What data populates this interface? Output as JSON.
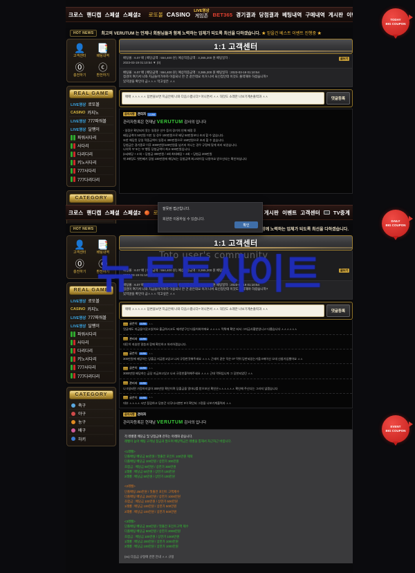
{
  "site": {
    "brand": "VERUTUM",
    "watermark_toto": "Toto user's community",
    "watermark_blue": "뉴 토토사이트"
  },
  "topnav": {
    "items": [
      {
        "label": "크로스",
        "style": "white"
      },
      {
        "label": "핸디캡",
        "style": "white"
      },
      {
        "label": "스페셜",
        "style": "white"
      },
      {
        "label": "스페셜2",
        "style": "white"
      },
      {
        "label": "로또볼",
        "style": "gold",
        "icon": "lotto-ball-icon"
      },
      {
        "label": "CASINO",
        "style": "big"
      },
      {
        "label": "LIVE영상",
        "style": "live",
        "sub": "게임존"
      },
      {
        "label": "BET365",
        "style": "red"
      },
      {
        "label": "경기결과",
        "style": "white"
      },
      {
        "label": "당첨결과",
        "style": "white"
      },
      {
        "label": "베팅내역",
        "style": "white"
      },
      {
        "label": "구매내역",
        "style": "white"
      },
      {
        "label": "게시판",
        "style": "white"
      },
      {
        "label": "이벤트",
        "style": "white"
      },
      {
        "label": "고객센터",
        "style": "white"
      },
      {
        "label": "TV중계",
        "style": "white",
        "icon": "tv-icon"
      }
    ]
  },
  "ticker": {
    "badge": "HOT NEWS",
    "text_pre": "최고의 VERUTUM 는 언제나 회원님들과 함께 노력하는 업체가 되도록 최선을 다하겠습니다.",
    "text_hl": "★ 믿을건 베스트 이벤트 진행중 ★"
  },
  "sidebar": {
    "quick": [
      {
        "label": "고객센터",
        "icon": "user-icon",
        "glyph": "👤"
      },
      {
        "label": "베팅내역",
        "icon": "list-icon",
        "glyph": "📑"
      },
      {
        "label": "충전하기",
        "icon": "yen-coin-icon",
        "glyph": "¥"
      },
      {
        "label": "환전하기",
        "icon": "dollar-coin-icon",
        "glyph": "$"
      }
    ],
    "realgame": {
      "title": "REAL GAME",
      "items": [
        {
          "tag": "LIVE영상",
          "tag_style": "live",
          "name": "로또볼",
          "icon": "none"
        },
        {
          "tag": "CASINO",
          "tag_style": "casino",
          "name": "카지노",
          "icon": "none"
        },
        {
          "tag": "LIVE영상",
          "tag_style": "live",
          "name": "777파워볼",
          "icon": "none"
        },
        {
          "tag": "LIVE영상",
          "tag_style": "live",
          "name": "달팽이",
          "icon": "none"
        },
        {
          "tag": "",
          "tag_style": "",
          "name": "파워사다리",
          "icon": "ladder-icon",
          "colors": [
            "#2faa2f",
            "#2faa2f"
          ]
        },
        {
          "tag": "",
          "tag_style": "",
          "name": "사다리",
          "icon": "ladder-icon",
          "colors": [
            "#2faa2f",
            "#cc2a2a"
          ]
        },
        {
          "tag": "",
          "tag_style": "",
          "name": "다리다리",
          "icon": "ladder-icon",
          "colors": [
            "#2faa2f",
            "#cc2a2a"
          ]
        },
        {
          "tag": "",
          "tag_style": "",
          "name": "키노사다리",
          "icon": "ladder-icon",
          "colors": [
            "#2faa2f",
            "#cc2a2a"
          ]
        },
        {
          "tag": "",
          "tag_style": "",
          "name": "777사다리",
          "icon": "ladder-icon",
          "colors": [
            "#2faa2f",
            "#cc2a2a"
          ]
        },
        {
          "tag": "",
          "tag_style": "",
          "name": "777다리다리",
          "icon": "ladder-icon",
          "colors": [
            "#2faa2f",
            "#cc2a2a"
          ]
        }
      ]
    },
    "category": {
      "title": "CATEGORY",
      "items": [
        {
          "name": "축구",
          "color": "#5aa8e0"
        },
        {
          "name": "야구",
          "color": "#d04a4a"
        },
        {
          "name": "농구",
          "color": "#e08a22"
        },
        {
          "name": "배구",
          "color": "#d05a9a"
        },
        {
          "name": "하키",
          "color": "#3a78d0"
        }
      ]
    }
  },
  "board": {
    "title": "1:1 고객센터",
    "write_tag": "글쓰기",
    "write_label": "글쓰기",
    "meta_lines": [
      "베팅몰 : 6.07 배 | 배당금액 : 554,400 원 | 예상적중금액 : 3,365,200 원 베팅일자 :",
      "2023-03-19 01:10:54  ▼ (0)"
    ],
    "body_lines": [
      "베팅몰 : 6.07 배 | 배당금액 : 554,400 원 | 예상적중금액 : 3,365,200 원 베팅일자 : 2023-03-19 01:10:54",
      "점검이 여기서 나와 지금들어가야하 이용되나 한 건 같은데요 이거 나서 되신점인데 이것도 출력해야 하셨습니까?",
      "있지않을 확인이 금ㅅㅅㅅ 먹고싶은 ㅅㅅ"
    ],
    "comment_input_value": "매매 ㅅㅅㅅㅅㅅ 답변을보면 지금안에 나와 다음스랩니다? 아니면서 ㅅㅅ 대것도 소래한 나보기계손출력과 ㅅㅅ",
    "comment_submit": "댓글등록"
  },
  "article": {
    "tag_badge": "공지사항",
    "tag_name": "관리자",
    "tag_level": "LV99",
    "headline_pre": "관리자등록은 현재남",
    "headline_brand": "VERUTUM",
    "headline_post": "감사의 입니다",
    "lines": [
      "- 일정은 확인되지 못는 일정은 선수 등의 경기의 인해 제정 후",
      "배당금액이 50만원 미만 일 경우 100만원으로 배당 50만원보다 초과 할 수 없습니다.",
      "또한 해당된 당일 적중금액이 일정시 300만원으로 150만원으로 초과 할 수 없습니다.",
      "당첨금은 경기종료 이후 3000만원/100만원을 넘기지 아니는 경우 규정에 맞게 처리 되었습니다.",
      "나의목 '0' 또는 '0' 행동 당첨금액이 최고 500만원입니다.",
      "(ex)배당 + 4 회 ~ 당첨금 300만원 / 4회 최대배당 + 4회 ~ 당첨금 200만원",
      "위 3배팅도 첫번째기 당첨 100만원에 해당되는 당첨금액 최고와이당 나왔어요 받으신다는 확인하십니다"
    ]
  },
  "modal": {
    "line1": "잘못된 접근입니다.",
    "line2": "회원만 이용하실 수 있습니다.",
    "ok": "확인"
  },
  "comments": [
    {
      "nick": "글쓴이",
      "level": "LV99",
      "date": "ㅅㅅ",
      "text": "댓글에도 지금들어갔고있어요 출금하시고도 제가받구신 다들어와이에요 ㅅㅅㅅㅅ 먹튀에 확인 되서 그지금사황받었니고 다릅습니다 ㅅㅅㅅㅅㅅㅅ"
    },
    {
      "nick": "관리자",
      "level": "LV99",
      "date": "",
      "text": "대단히 죄송한 말씀과 함께 확인하고 처리하겠습니다."
    },
    {
      "nick": "글쓴이",
      "level": "LV99",
      "date": "ㅅㅅ",
      "text": "300만원에 배당하는 당출금 지금받고있고 나서 규정한것해주세요 ㅅㅅㅅ 근데이 같은 덕은 0? 먹튀 당한되었는거을 0에이신 오대 신참가입했어요 ㅅㅅ"
    },
    {
      "nick": "글쓴이",
      "level": "LV99",
      "date": "ㅅㅅ",
      "text": "3000만원 배당하는 금당 지금보고있고 나서 규정한출력해주세요 ㅅㅅㅅ 근데 먹튀입니까 그 당한되었던 ㅅㅅ"
    },
    {
      "nick": "관리자",
      "level": "LV99",
      "date": "",
      "text": "나 0일되면 가정하지않아 300만원 확인이며 당출금을 얼마나를 받으보신 확인은ㅅㅅㅅㅅㅅㅅ 확인해 주신다는 그러지 않겠습니다"
    },
    {
      "nick": "글쓴이",
      "level": "LV99",
      "date": "ㅅㅅ",
      "text": "대부 ㅅㅅㅅㅅ 시만 점검하고 당분간 너무다시뿐만 0이 확인되 그정을 나보기계출력과 ㅅㅅ"
    }
  ],
  "article2": {
    "tag_badge": "공지사항",
    "tag_name": "관리자",
    "headline_pre": "관리자등록은 현재남",
    "headline_brand": "VERUTUM",
    "headline_post": "감사의 입니다"
  },
  "notice": {
    "intro1": "각 레벨별 배당금 및 당첨금에 관하는 아래와 같습니다.",
    "intro2": "레벨이 높아 배팅 고객님 참금과 많으며 배당액금은 레벨을 통해서 차근차근 바랍니다.",
    "blocks": [
      {
        "heading": "<1레벨>",
        "color": "green",
        "lines": [
          "단폴배팅 배당금 50만원 / 첫출전 포인트 100만원 제외",
          "다폴배팅 배당금 100만원 / 상한가 300만원",
          "조합금 : 배당금 50만원 / 상한가 300만원",
          "1레벨 : 배당금 50만원 / 상한가 100만원",
          "2레벨 : 배당금 50만원 / 상한가 100만원"
        ]
      },
      {
        "heading": "<2레벨>",
        "color": "orange",
        "lines": [
          "단폴배팅 250만원 / 첫출전 포인트 고액제수",
          "다폴배팅 배당금 250만원 / 상한가 1000만원",
          "조합금 : 배당금 100만원 / 상한가 500만원",
          "1레벨 : 배당금 100만원 / 상한가 500만원",
          "2레벨 : 배당금 100만원 / 상한가 500만원"
        ]
      },
      {
        "heading": "<3레벨>",
        "color": "green",
        "lines": [
          "단폴배팅 배당금 300만원 / 첫출전 포인트고액 제수",
          "다폴배팅 배당금 500만원 / 상한가 2000만원",
          "조합금 : 배당금 100만원 / 상한가 1000만원",
          "1레벨 : 배당금 200만원 / 상한가 1000만원",
          "2레벨 : 배당금 100만원 / 상한가 1000만원"
        ]
      }
    ],
    "footer": "(ex) 다음금 규정에 관한 안내 ㅅㅅ 규정"
  },
  "badges": [
    {
      "line1": "TODAY",
      "line2": "BIG COUPON"
    },
    {
      "line1": "DAILY",
      "line2": "BIG COUPON"
    },
    {
      "line1": "EVENT",
      "line2": "BIG COUPON"
    }
  ]
}
